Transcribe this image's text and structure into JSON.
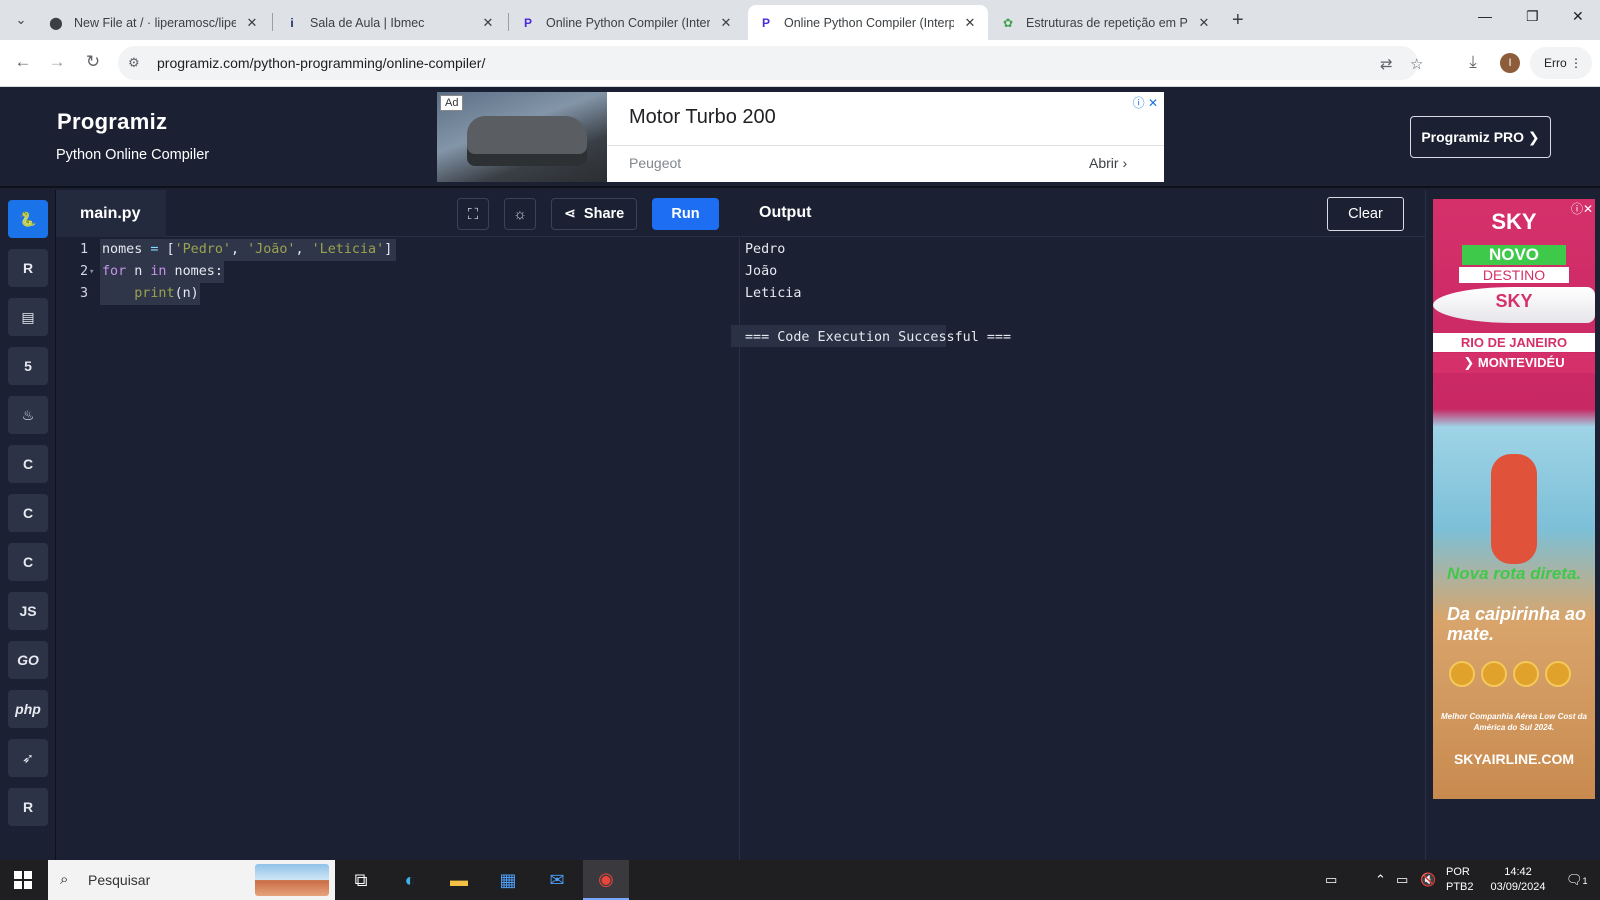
{
  "browser": {
    "tabs": [
      {
        "title": "New File at / · liperamosc/liperamosc",
        "favicon": "github-icon"
      },
      {
        "title": "Sala de Aula | Ibmec",
        "favicon": "ibmec-icon"
      },
      {
        "title": "Online Python Compiler (Interpreter)",
        "favicon": "programiz-icon"
      },
      {
        "title": "Online Python Compiler (Interpreter)",
        "favicon": "programiz-icon",
        "active": true
      },
      {
        "title": "Estruturas de repetição em Python",
        "favicon": "green-site-icon"
      }
    ],
    "url": "programiz.com/python-programming/online-compiler/",
    "profile_initial": "I",
    "profile_status": "Erro"
  },
  "site": {
    "logo": "Programiz",
    "subtitle": "Python Online Compiler",
    "pro_button": "Programiz PRO ❯"
  },
  "top_ad": {
    "tag": "Ad",
    "title": "Motor Turbo 200",
    "brand": "Peugeot",
    "open": "Abrir"
  },
  "sidebar": {
    "languages": [
      {
        "name": "python",
        "label": "🐍",
        "active": true
      },
      {
        "name": "r",
        "label": "R"
      },
      {
        "name": "sql",
        "label": "▤"
      },
      {
        "name": "html",
        "label": "5"
      },
      {
        "name": "java",
        "label": "♨"
      },
      {
        "name": "c",
        "label": "C"
      },
      {
        "name": "cpp",
        "label": "C"
      },
      {
        "name": "csharp",
        "label": "C"
      },
      {
        "name": "javascript",
        "label": "JS"
      },
      {
        "name": "go",
        "label": "GO"
      },
      {
        "name": "php",
        "label": "php"
      },
      {
        "name": "swift",
        "label": "➶"
      },
      {
        "name": "rust",
        "label": "R"
      }
    ]
  },
  "editor": {
    "filename": "main.py",
    "share_label": "Share",
    "run_label": "Run",
    "lines": [
      {
        "num": "1",
        "tokens": [
          [
            "id",
            "nomes"
          ],
          [
            "op",
            " = "
          ],
          [
            "id",
            "["
          ],
          [
            "strg",
            "'Pedro'"
          ],
          [
            "id",
            ", "
          ],
          [
            "strg",
            "'João'"
          ],
          [
            "id",
            ", "
          ],
          [
            "strg",
            "'Leticia'"
          ],
          [
            "id",
            "]"
          ]
        ]
      },
      {
        "num": "2",
        "tokens": [
          [
            "kw",
            "for"
          ],
          [
            "id",
            " n "
          ],
          [
            "kw",
            "in"
          ],
          [
            "id",
            " nomes:"
          ]
        ]
      },
      {
        "num": "3",
        "tokens": [
          [
            "id",
            "    "
          ],
          [
            "strg",
            "print"
          ],
          [
            "id",
            "(n)"
          ]
        ]
      }
    ]
  },
  "output": {
    "title": "Output",
    "clear_label": "Clear",
    "lines": [
      "Pedro",
      "João",
      "Leticia",
      "",
      "=== Code Execution Successful ==="
    ]
  },
  "side_ad": {
    "logo": "SKY",
    "pill": "NOVO",
    "dest": "DESTINO",
    "plane_text": "SKY",
    "route1": "RIO DE JANEIRO",
    "route2": "❯ MONTEVIDÉU",
    "green_text": "Nova rota direta.",
    "white_text": "Da caipirinha ao mate.",
    "small_text": "Melhor Companhia Aérea Low Cost da América do Sul 2024.",
    "url": "SKYAIRLINE.COM"
  },
  "taskbar": {
    "search_placeholder": "Pesquisar",
    "lang_line1": "POR",
    "lang_line2": "PTB2",
    "time": "14:42",
    "date": "03/09/2024",
    "notif_count": "1"
  }
}
